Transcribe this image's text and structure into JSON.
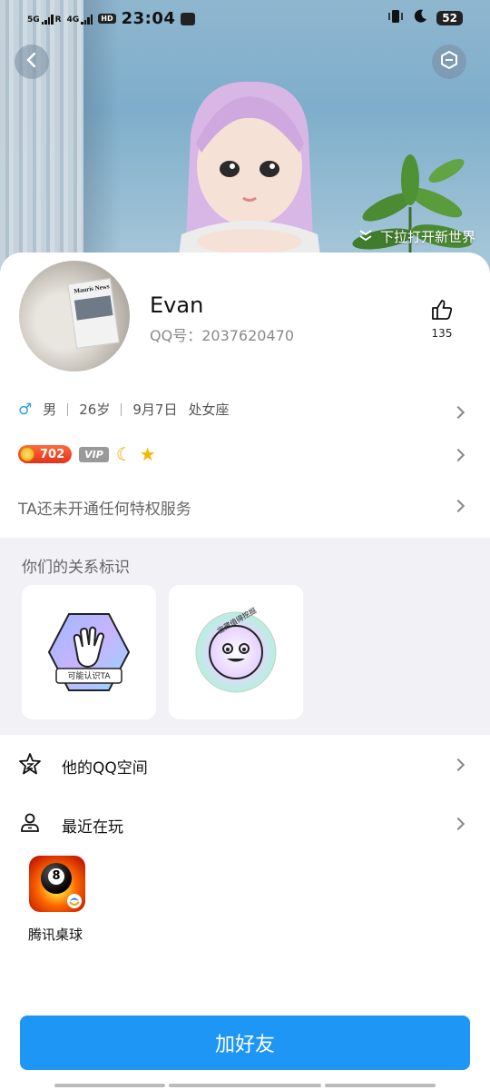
{
  "status_bar": {
    "network_1": "5G",
    "network_1_sub": "R",
    "network_2": "4G",
    "hd_badge": "HD",
    "time": "23:04",
    "battery": "52"
  },
  "hero": {
    "pull_hint": "下拉打开新世界"
  },
  "profile": {
    "nickname": "Evan",
    "qq_label": "QQ号：",
    "qq_number": "2037620470",
    "likes": "135",
    "gender_symbol": "♂",
    "gender": "男",
    "age": "26岁",
    "birthday": "9月7日",
    "zodiac": "处女座",
    "avatar_text": "Mauris News"
  },
  "badges": {
    "coin_level": "702",
    "vip": "VIP"
  },
  "privilege_text": "TA还未开通任何特权服务",
  "relation": {
    "title": "你们的关系标识",
    "tile_1_label": "可能认识TA",
    "tile_2_label": "宝藏值得挖掘"
  },
  "menu": {
    "qzone": "他的QQ空间",
    "recent": "最近在玩"
  },
  "recent_game": {
    "name": "腾讯桌球",
    "ball_number": "8"
  },
  "add_friend_button": "加好友",
  "colors": {
    "primary": "#1e96f5",
    "male": "#2aa0e6",
    "section_bg": "#f2f2f6"
  }
}
